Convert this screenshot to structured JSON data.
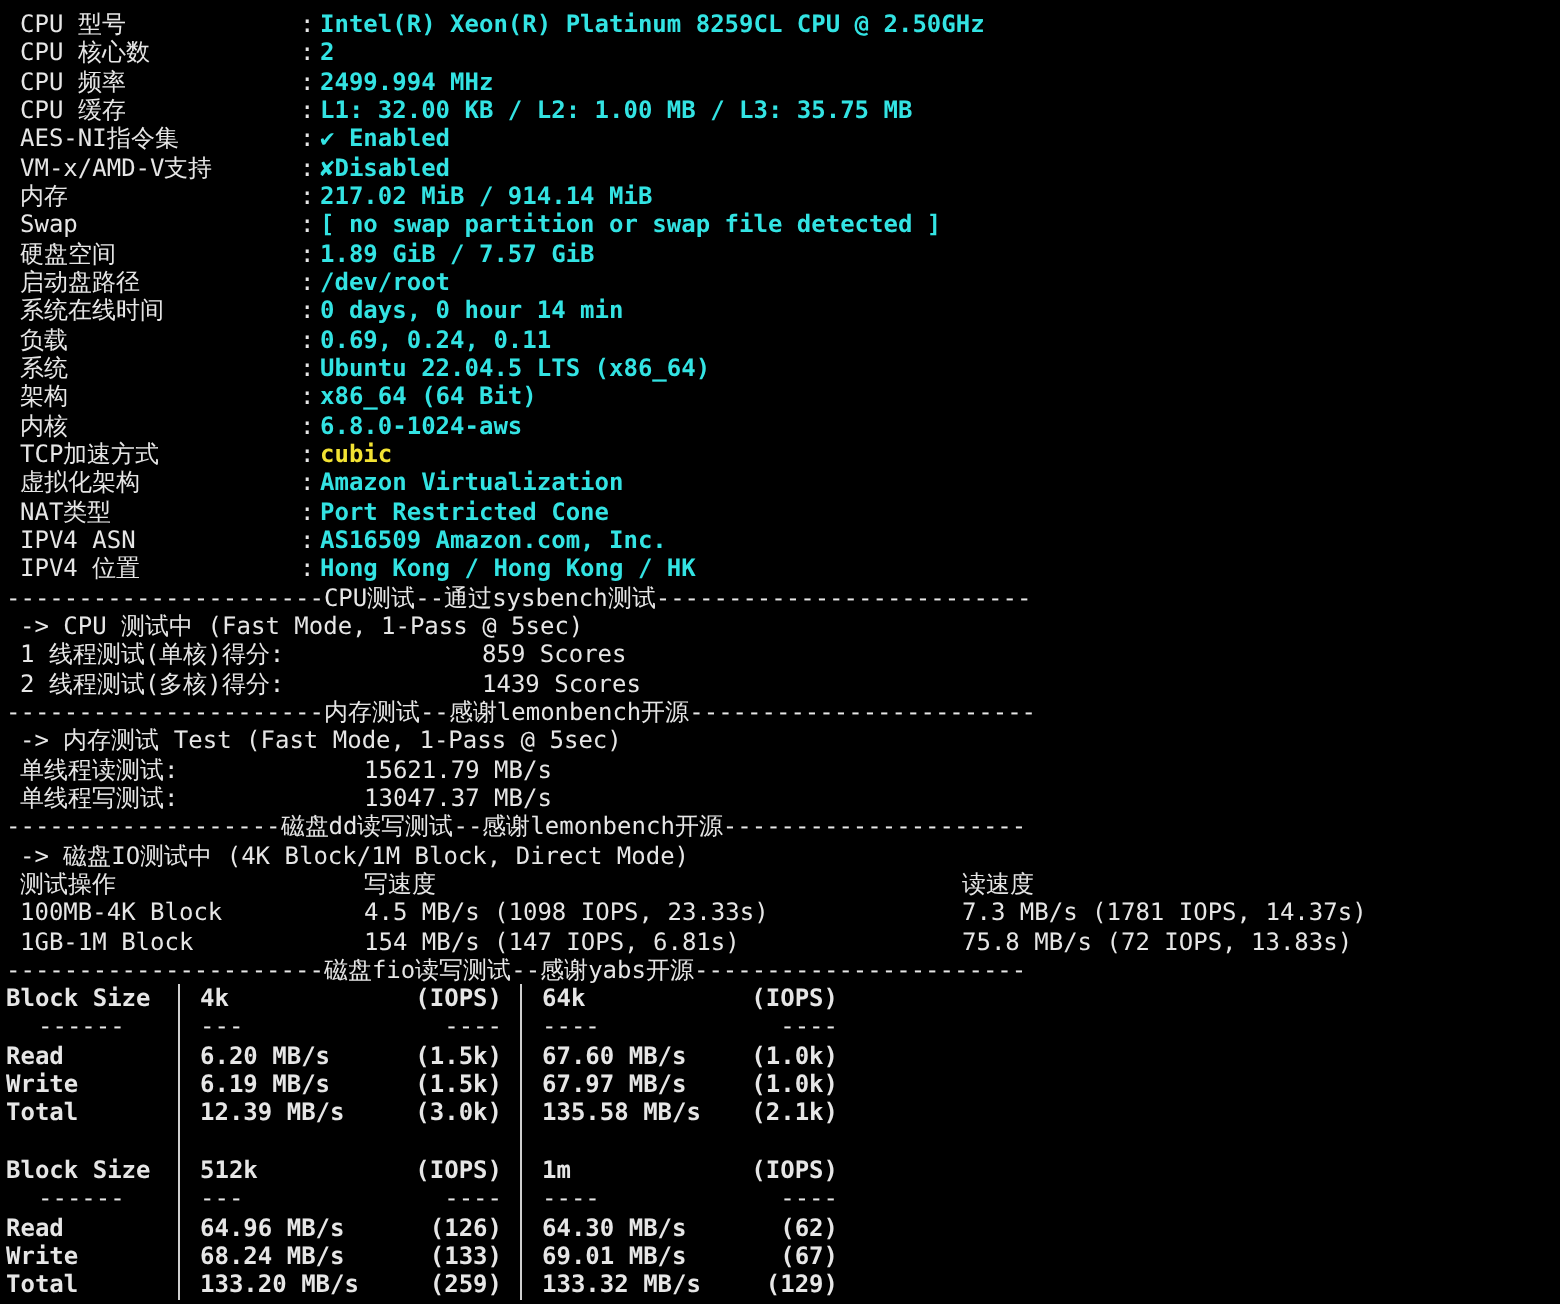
{
  "system_info": {
    "separator": ":",
    "rows": [
      {
        "label": "CPU 型号",
        "value": "Intel(R) Xeon(R) Platinum 8259CL CPU @ 2.50GHz",
        "color": "#33e3e3"
      },
      {
        "label": "CPU 核心数",
        "value": "2",
        "color": "#33e3e3"
      },
      {
        "label": "CPU 频率",
        "value": "2499.994 MHz",
        "color": "#33e3e3"
      },
      {
        "label": "CPU 缓存",
        "value": "L1: 32.00 KB / L2: 1.00 MB / L3: 35.75 MB",
        "color": "#33e3e3"
      },
      {
        "label": "AES-NI指令集",
        "value": "✔ Enabled",
        "color": "#33e3e3"
      },
      {
        "label": "VM-x/AMD-V支持",
        "value": "✘Disabled",
        "color": "#33e3e3"
      },
      {
        "label": "内存",
        "value": "217.02 MiB / 914.14 MiB",
        "color": "#33e3e3"
      },
      {
        "label": "Swap",
        "value": "[ no swap partition or swap file detected ]",
        "color": "#33e3e3"
      },
      {
        "label": "硬盘空间",
        "value": "1.89 GiB / 7.57 GiB",
        "color": "#33e3e3"
      },
      {
        "label": "启动盘路径",
        "value": "/dev/root",
        "color": "#33e3e3"
      },
      {
        "label": "系统在线时间",
        "value": "0 days, 0 hour 14 min",
        "color": "#33e3e3"
      },
      {
        "label": "负载",
        "value": "0.69, 0.24, 0.11",
        "color": "#33e3e3"
      },
      {
        "label": "系统",
        "value": "Ubuntu 22.04.5 LTS (x86_64)",
        "color": "#33e3e3"
      },
      {
        "label": "架构",
        "value": "x86_64 (64 Bit)",
        "color": "#33e3e3"
      },
      {
        "label": "内核",
        "value": "6.8.0-1024-aws",
        "color": "#33e3e3"
      },
      {
        "label": "TCP加速方式",
        "value": "cubic",
        "color": "#f2e233"
      },
      {
        "label": "虚拟化架构",
        "value": "Amazon Virtualization",
        "color": "#33e3e3"
      },
      {
        "label": "NAT类型",
        "value": "Port Restricted Cone",
        "color": "#33e3e3"
      },
      {
        "label": "IPV4 ASN",
        "value": "AS16509 Amazon.com, Inc.",
        "color": "#33e3e3"
      },
      {
        "label": "IPV4 位置",
        "value": "Hong Kong / Hong Kong / HK",
        "color": "#33e3e3"
      }
    ]
  },
  "cpu_benchmark": {
    "divider": "----------------------CPU测试--通过sysbench测试--------------------------",
    "heading": "-> CPU 测试中 (Fast Mode, 1-Pass @ 5sec)",
    "results": [
      {
        "label": "1 线程测试(单核)得分:",
        "value": "859 Scores"
      },
      {
        "label": "2 线程测试(多核)得分:",
        "value": "1439 Scores"
      }
    ]
  },
  "memory_benchmark": {
    "divider": "----------------------内存测试--感谢lemonbench开源------------------------",
    "heading": "-> 内存测试 Test (Fast Mode, 1-Pass @ 5sec)",
    "results": [
      {
        "label": "单线程读测试:",
        "value": "15621.79 MB/s"
      },
      {
        "label": "单线程写测试:",
        "value": "13047.37 MB/s"
      }
    ]
  },
  "disk_dd": {
    "divider": "-------------------磁盘dd读写测试--感谢lemonbench开源---------------------",
    "heading": "-> 磁盘IO测试中 (4K Block/1M Block, Direct Mode)",
    "columns": [
      "测试操作",
      "写速度",
      "读速度"
    ],
    "rows": [
      [
        "100MB-4K Block",
        "4.5 MB/s (1098 IOPS, 23.33s)",
        "7.3 MB/s (1781 IOPS, 14.37s)"
      ],
      [
        "1GB-1M Block",
        "154 MB/s (147 IOPS, 6.81s)",
        "75.8 MB/s (72 IOPS, 13.83s)"
      ]
    ]
  },
  "disk_fio": {
    "divider": "----------------------磁盘fio读写测试--感谢yabs开源-----------------------",
    "tables": [
      {
        "rows": [
          {
            "kind": "header",
            "cells": [
              "Block Size",
              "4k",
              "(IOPS)",
              "64k",
              "(IOPS)"
            ]
          },
          {
            "kind": "rule",
            "cells": [
              "------",
              "---",
              "----",
              "----",
              "----"
            ]
          },
          {
            "kind": "data",
            "cells": [
              "Read",
              "6.20 MB/s",
              "(1.5k)",
              "67.60 MB/s",
              "(1.0k)"
            ]
          },
          {
            "kind": "data",
            "cells": [
              "Write",
              "6.19 MB/s",
              "(1.5k)",
              "67.97 MB/s",
              "(1.0k)"
            ]
          },
          {
            "kind": "data",
            "cells": [
              "Total",
              "12.39 MB/s",
              "(3.0k)",
              "135.58 MB/s",
              "(2.1k)"
            ]
          }
        ]
      },
      {
        "rows": [
          {
            "kind": "header",
            "cells": [
              "Block Size",
              "512k",
              "(IOPS)",
              "1m",
              "(IOPS)"
            ]
          },
          {
            "kind": "rule",
            "cells": [
              "------",
              "---",
              "----",
              "----",
              "----"
            ]
          },
          {
            "kind": "data",
            "cells": [
              "Read",
              "64.96 MB/s",
              "(126)",
              "64.30 MB/s",
              "(62)"
            ]
          },
          {
            "kind": "data",
            "cells": [
              "Write",
              "68.24 MB/s",
              "(133)",
              "69.01 MB/s",
              "(67)"
            ]
          },
          {
            "kind": "data",
            "cells": [
              "Total",
              "133.20 MB/s",
              "(259)",
              "133.32 MB/s",
              "(129)"
            ]
          }
        ]
      }
    ]
  }
}
